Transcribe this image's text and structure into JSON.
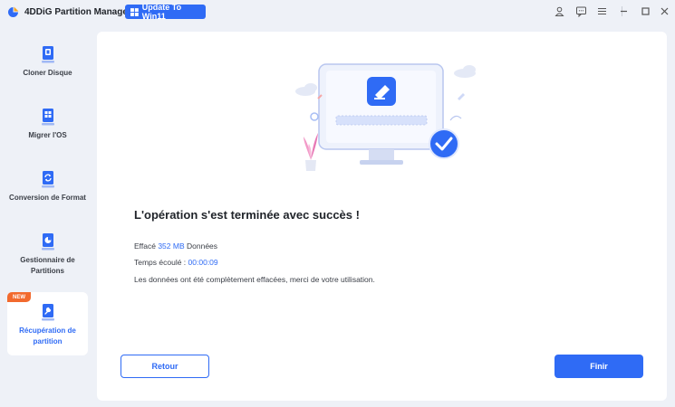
{
  "app": {
    "title": "4DDiG Partition Manager",
    "update_button": "Update To Win11"
  },
  "titlebar_icons": [
    "user-icon",
    "feedback-icon",
    "menu-icon",
    "minimize-icon",
    "maximize-icon",
    "close-icon"
  ],
  "sidebar": {
    "items": [
      {
        "label": "Cloner Disque",
        "icon": "clone-disk-icon"
      },
      {
        "label": "Migrer l'OS",
        "icon": "migrate-os-icon"
      },
      {
        "label": "Conversion de Format",
        "icon": "format-conversion-icon"
      },
      {
        "label": "Gestionnaire de Partitions",
        "icon": "partition-manager-icon"
      },
      {
        "label": "Récupération de partition",
        "icon": "partition-recovery-icon",
        "badge": "NEW",
        "active": true
      }
    ]
  },
  "main": {
    "title": "L'opération s'est terminée avec succès !",
    "erased_prefix": "Effacé",
    "erased_value": "352 MB",
    "erased_suffix": "Données",
    "elapsed_prefix": "Temps écoulé :",
    "elapsed_value": "00:00:09",
    "message": "Les données ont été complètement effacées, merci de votre utilisation.",
    "back_button": "Retour",
    "finish_button": "Finir"
  },
  "colors": {
    "accent": "#2f6bf5",
    "badge": "#f26a2e",
    "background": "#eef1f7"
  }
}
